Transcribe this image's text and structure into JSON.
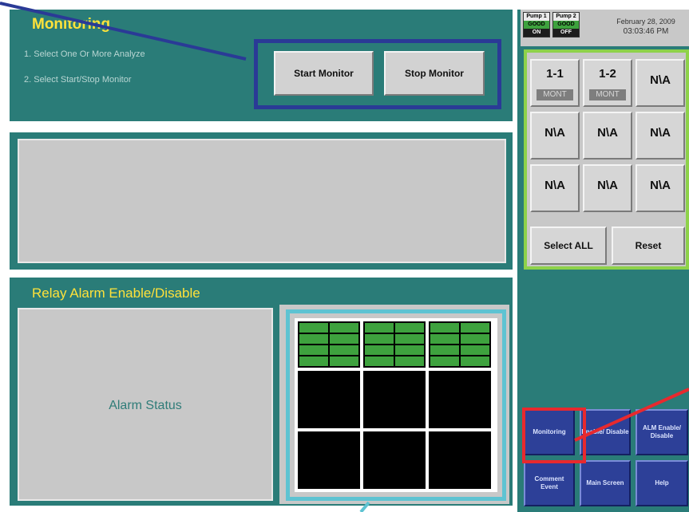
{
  "monitoring": {
    "title": "Monitoring",
    "instruction_1": "1.  Select One Or More Analyze",
    "instruction_2": "2.  Select Start/Stop Monitor",
    "start_button": "Start Monitor",
    "stop_button": "Stop Monitor",
    "frame_color": "#2a3a96"
  },
  "relay": {
    "title": "Relay Alarm Enable/Disable",
    "alarm_status": "Alarm Status",
    "frame_color": "#5ec3d2"
  },
  "status_bar": {
    "pumps": [
      {
        "name": "Pump 1",
        "health": "GOOD",
        "state": "ON"
      },
      {
        "name": "Pump 2",
        "health": "GOOD",
        "state": "OFF"
      }
    ],
    "date": "February 28, 2009",
    "time": "03:03:46 PM"
  },
  "analyzers": {
    "frame_color": "#8ed24a",
    "buttons": [
      {
        "label": "1-1",
        "status": "MONT"
      },
      {
        "label": "1-2",
        "status": "MONT"
      },
      {
        "label": "N\\A"
      },
      {
        "label": "N\\A"
      },
      {
        "label": "N\\A"
      },
      {
        "label": "N\\A"
      },
      {
        "label": "N\\A"
      },
      {
        "label": "N\\A"
      },
      {
        "label": "N\\A"
      }
    ],
    "select_all": "Select ALL",
    "reset": "Reset"
  },
  "menu": {
    "monitoring": "Monitoring",
    "enable_disable": "Enable/ Disable",
    "alm_enable_disable": "ALM Enable/ Disable",
    "comment_event": "Comment Event",
    "main_screen": "Main Screen",
    "help": "Help"
  },
  "colors": {
    "panel": "#2a7c78",
    "title_yellow": "#ffe23a",
    "highlight_red": "#e8292e",
    "relay_green": "#3ea23e"
  }
}
